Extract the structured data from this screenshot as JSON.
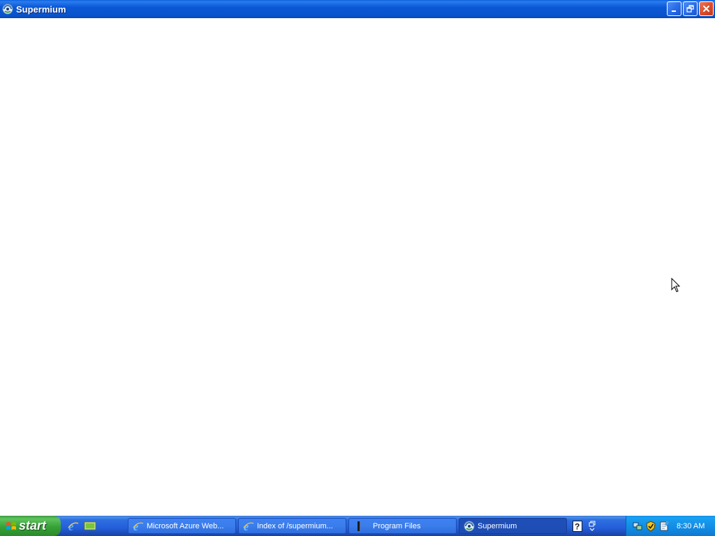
{
  "window": {
    "title": "Supermium",
    "app_icon": "supermium-icon",
    "caption_buttons": [
      "minimize-icon",
      "restore-icon",
      "close-icon"
    ]
  },
  "taskbar": {
    "start_label": "start",
    "quick_launch": [
      "internet-explorer-icon",
      "show-desktop-icon"
    ],
    "tasks": [
      {
        "label": "Microsoft Azure Web...",
        "icon": "internet-explorer-icon",
        "active": false
      },
      {
        "label": "Index of /supermium...",
        "icon": "internet-explorer-icon",
        "active": false
      },
      {
        "label": "Program Files",
        "icon": "folder-icon",
        "active": false
      },
      {
        "label": "Supermium",
        "icon": "supermium-icon",
        "active": true
      }
    ],
    "mid_icons": [
      "help-icon",
      "restore-down-icon"
    ],
    "tray_icons": [
      "network-icon",
      "antivirus-icon",
      "notepad-icon"
    ],
    "clock": "8:30 AM"
  },
  "colors": {
    "titlebar": "#0b58d6",
    "taskbar": "#245edb",
    "start_button": "#37a137",
    "tray": "#118be4",
    "close_button": "#d94b2b"
  }
}
